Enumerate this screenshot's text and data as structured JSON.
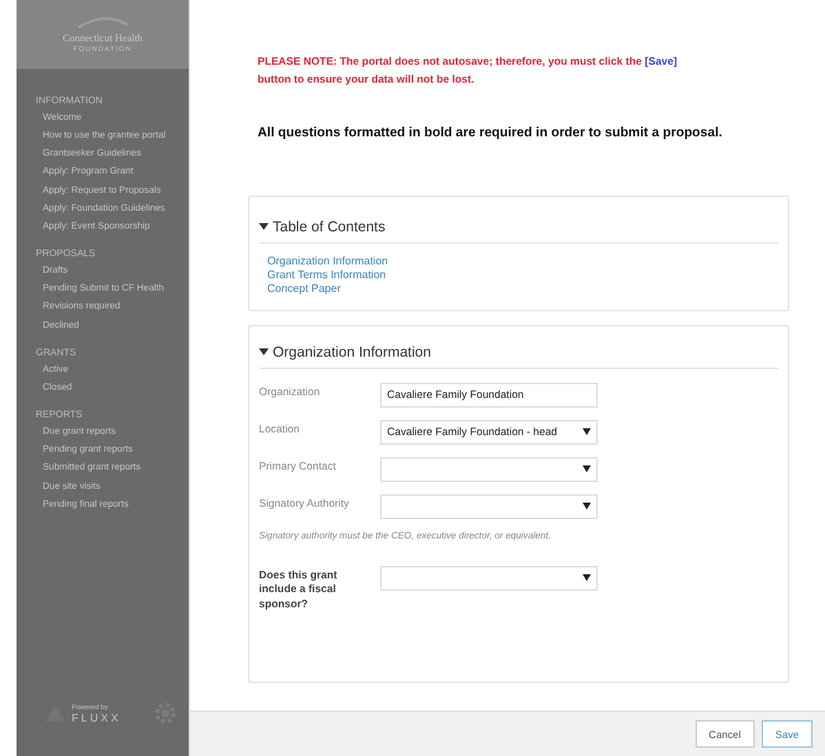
{
  "sidebar": {
    "logo": {
      "title": "Connecticut Health",
      "subtitle": "FOUNDATION"
    },
    "sections": [
      {
        "heading": "INFORMATION",
        "items": [
          "Welcome",
          "How to use the grantee portal",
          "Grantseeker Guidelines",
          "Apply: Program Grant",
          "Apply: Request to Proposals",
          "Apply: Foundation Guidelines",
          "Apply: Event Sponsorship"
        ]
      },
      {
        "heading": "PROPOSALS",
        "items": [
          "Drafts",
          "Pending Submit to CF Health",
          "Revisions required",
          "Declined"
        ]
      },
      {
        "heading": "GRANTS",
        "items": [
          "Active",
          "Closed"
        ]
      },
      {
        "heading": "REPORTS",
        "items": [
          "Due grant reports",
          "Pending grant reports",
          "Submitted grant reports",
          "Due site visits",
          "Pending final reports"
        ]
      }
    ],
    "footer": {
      "powered_by": "Powered by",
      "brand": "FLUXX"
    }
  },
  "notice": {
    "before": "PLEASE NOTE: The portal does not autosave;  therefore, you must click the ",
    "link": "[Save]",
    "after": " button to ensure your data will not be lost."
  },
  "requirement": "All questions formatted in bold are required in order to submit a proposal.",
  "toc": {
    "title": "Table of Contents",
    "expanded": true,
    "links": [
      "Organization Information",
      "Grant Terms Information",
      "Concept Paper"
    ]
  },
  "section": {
    "title": "Organization Information",
    "expanded": true,
    "fields": [
      {
        "kind": "text",
        "label": "Organization",
        "value": "Cavaliere Family Foundation",
        "required": false
      },
      {
        "kind": "select",
        "label": "Location",
        "value": "Cavaliere Family Foundation - head",
        "required": false
      },
      {
        "kind": "select",
        "label": "Primary Contact",
        "required": false
      },
      {
        "kind": "select",
        "label": "Signatory Authority",
        "required": false
      },
      {
        "kind": "note",
        "label": "Signatory authority must be the CEO, executive director, or equivalent."
      },
      {
        "kind": "select",
        "label": "Does this grant include a fiscal sponsor?",
        "required": true
      }
    ]
  },
  "buttons": [
    {
      "label": "Cancel",
      "kind": "default"
    },
    {
      "label": "Save",
      "kind": "primary"
    }
  ]
}
